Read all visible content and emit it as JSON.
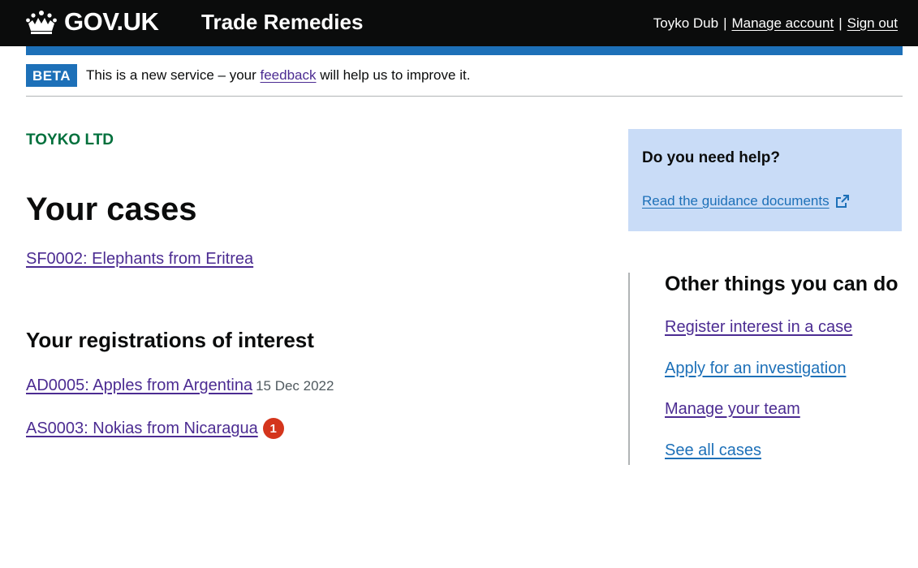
{
  "header": {
    "logo_text": "GOV.UK",
    "service_name": "Trade Remedies",
    "user_name": "Toyko Dub",
    "separator": "|",
    "manage_account": "Manage account",
    "sign_out": "Sign out"
  },
  "phase_banner": {
    "tag": "BETA",
    "text_before": "This is a new service – your",
    "link": "feedback",
    "text_after": "will help us to improve it."
  },
  "organisation": "TOYKO LTD",
  "page_title": "Your cases",
  "cases": [
    {
      "label": "SF0002: Elephants from Eritrea"
    }
  ],
  "registrations": {
    "title": "Your registrations of interest",
    "items": [
      {
        "label": "AD0005: Apples from Argentina",
        "date": "15 Dec 2022"
      },
      {
        "label": "AS0003: Nokias from Nicaragua",
        "badge": "1"
      }
    ]
  },
  "help": {
    "title": "Do you need help?",
    "link": "Read the guidance documents",
    "icon": "external-link-icon"
  },
  "other_things": {
    "title": "Other things you can do",
    "links": [
      "Register interest in a case",
      "Apply for an investigation",
      "Manage your team",
      "See all cases"
    ]
  },
  "colors": {
    "header_bg": "#0b0c0c",
    "brand_blue": "#1d70b8",
    "link_visited": "#4c2c92",
    "org_green": "#00703c",
    "help_bg": "#c9dcf7",
    "badge_red": "#d4351c"
  }
}
